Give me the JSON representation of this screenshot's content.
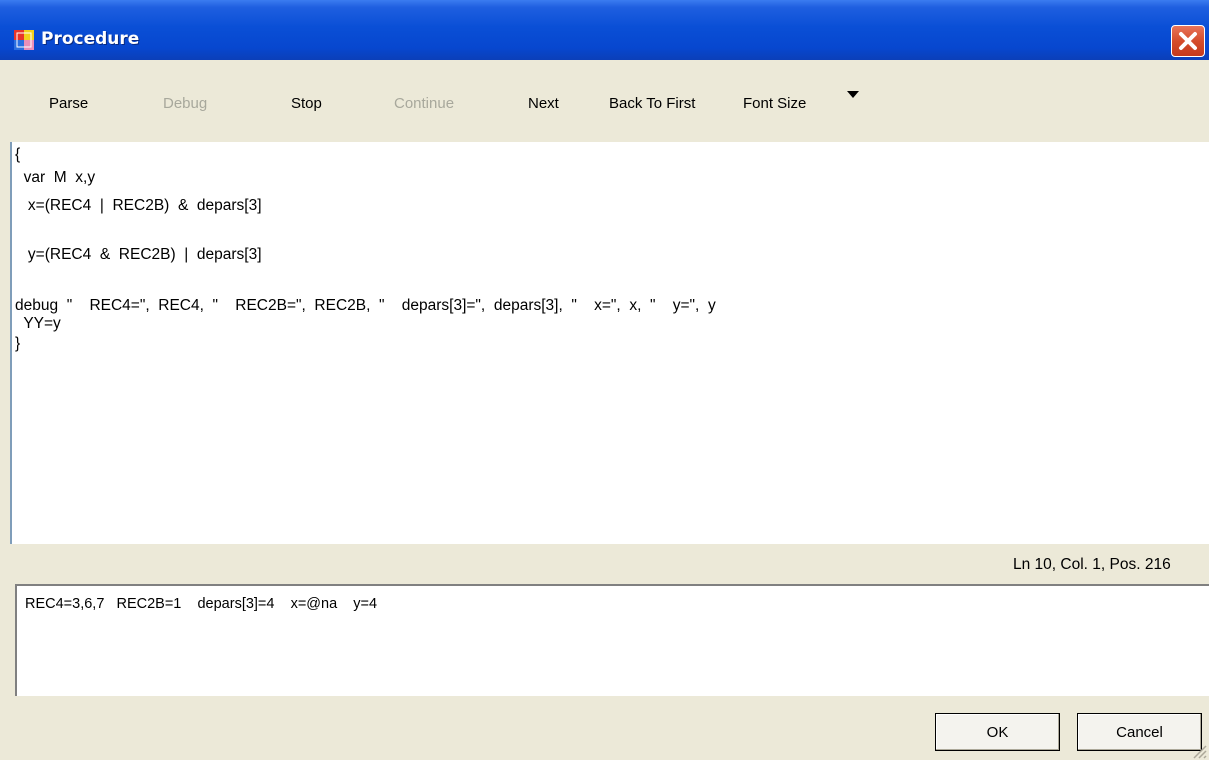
{
  "window": {
    "title": "Procedure",
    "close_icon": "close-icon",
    "app_icon": "procedure-app-icon"
  },
  "toolbar": {
    "buttons": [
      {
        "label": "Parse",
        "enabled": true
      },
      {
        "label": "Debug",
        "enabled": false
      },
      {
        "label": "Stop",
        "enabled": true
      },
      {
        "label": "Continue",
        "enabled": false
      },
      {
        "label": "Next",
        "enabled": true
      },
      {
        "label": "Back To First",
        "enabled": true
      },
      {
        "label": "Font Size",
        "enabled": true
      }
    ],
    "dropdown_icon": "triangle-down-icon"
  },
  "editor": {
    "lines": [
      "{",
      "  var  M  x,y",
      "   x=(REC4  |  REC2B)  &  depars[3]",
      "",
      "   y=(REC4  &  REC2B)  |  depars[3]",
      "",
      "debug  \"    REC4=\",  REC4,  \"    REC2B=\",  REC2B,  \"    depars[3]=\",  depars[3],  \"    x=\",  x,  \"    y=\",  y",
      "  YY=y",
      "}"
    ]
  },
  "status": {
    "position_text": "Ln 10, Col. 1, Pos. 216"
  },
  "output": {
    "text": "REC4=3,6,7   REC2B=1    depars[3]=4    x=@na    y=4"
  },
  "dialog": {
    "ok_label": "OK",
    "cancel_label": "Cancel"
  },
  "colors": {
    "titlebar": "#0a4fd6",
    "window_bg": "#ece9d8",
    "disabled_text": "#a8a89c",
    "close_button": "#d54d2c"
  }
}
